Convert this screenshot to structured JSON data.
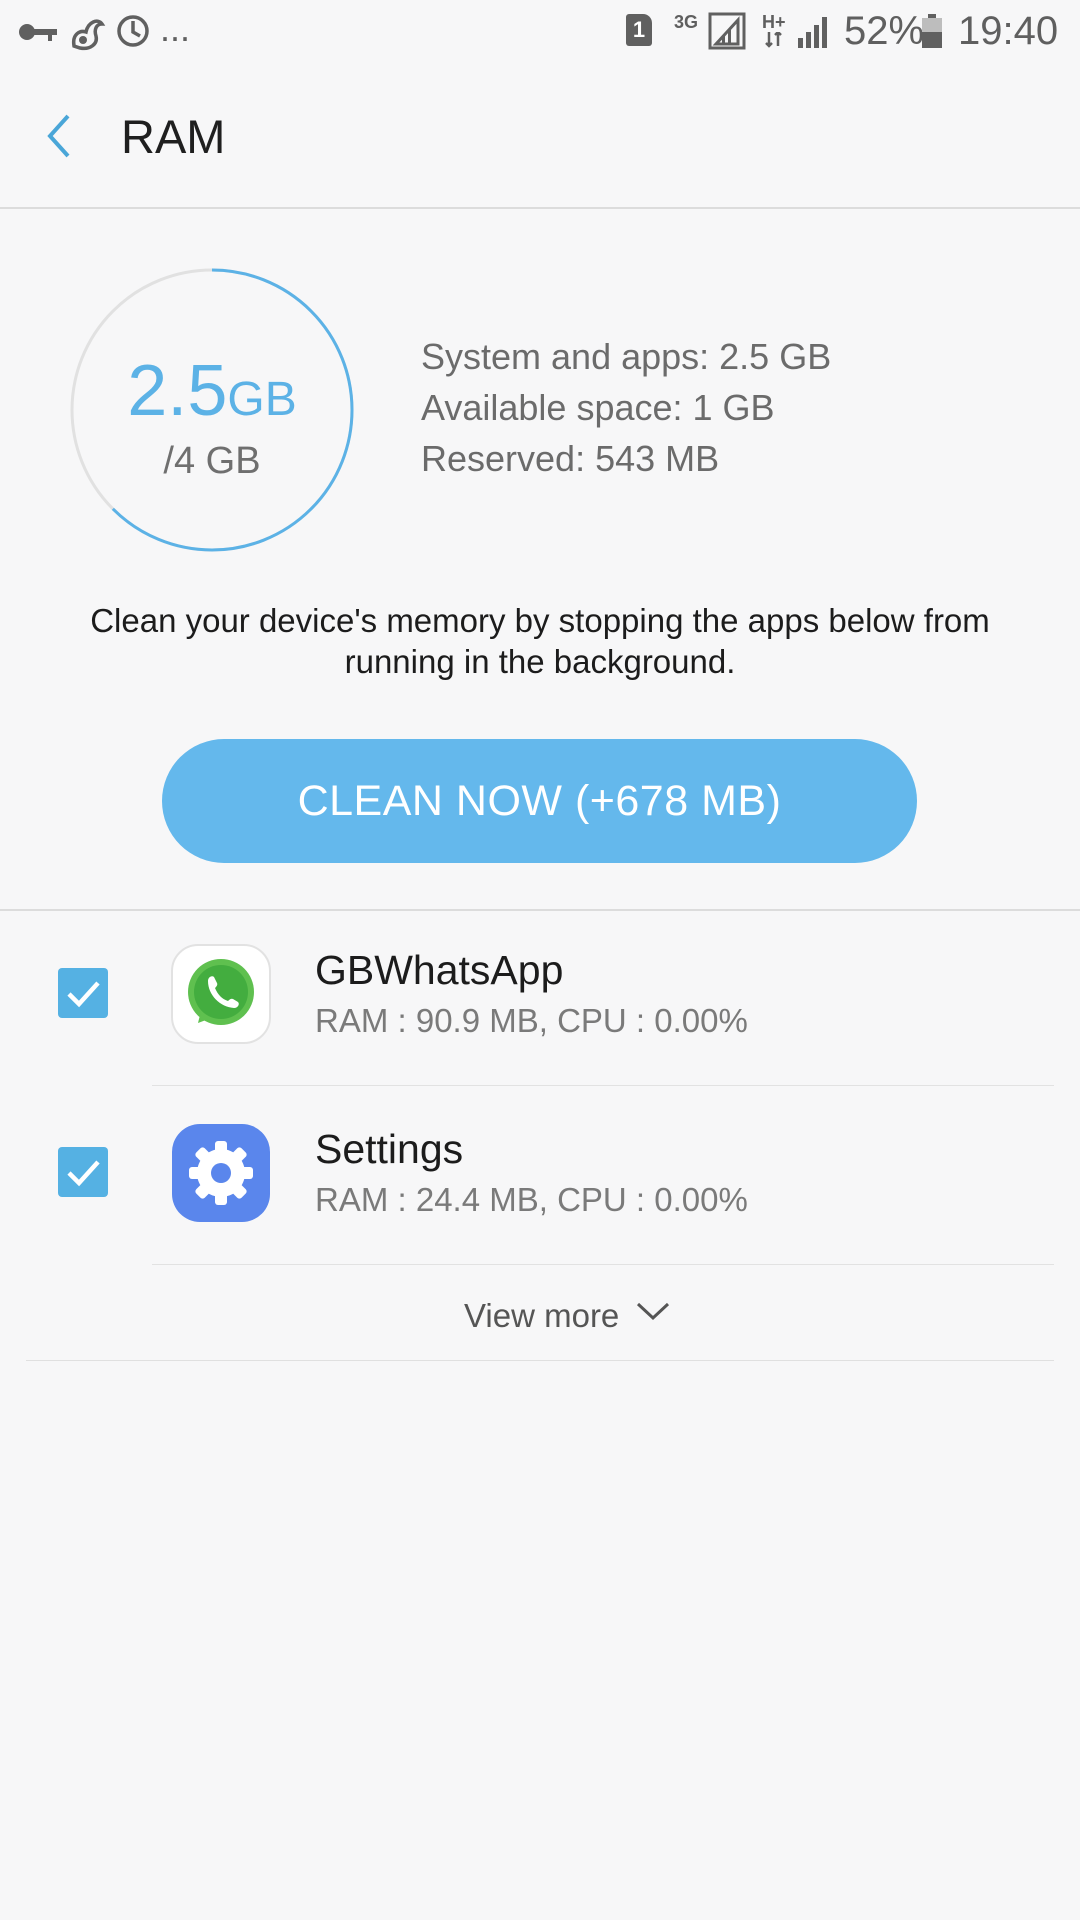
{
  "status_bar": {
    "left_icons": [
      "key-icon",
      "squirrel-icon",
      "sync-icon"
    ],
    "ellipsis": "...",
    "sim_slot": "1",
    "network_3g": "3G",
    "network_hplus": "H+",
    "battery_percent": "52%",
    "time": "19:40"
  },
  "header": {
    "back_icon": "chevron-left-icon",
    "title": "RAM"
  },
  "ram_summary": {
    "used_value": "2.5",
    "used_unit": "GB",
    "total": "/4 GB",
    "usage_fraction": 0.625,
    "accent_color": "#5cb2e6",
    "details": [
      "System and apps: 2.5 GB",
      "Available space: 1 GB",
      "Reserved: 543 MB"
    ]
  },
  "description": "Clean your device's memory by stopping the apps below from running in the background.",
  "clean_button": {
    "label": "CLEAN NOW (+678 MB)",
    "color": "#64b8ec"
  },
  "apps": [
    {
      "name": "GBWhatsApp",
      "stats": "RAM : 90.9 MB, CPU : 0.00%",
      "checked": true,
      "icon": "whatsapp-icon"
    },
    {
      "name": "Settings",
      "stats": "RAM : 24.4 MB, CPU : 0.00%",
      "checked": true,
      "icon": "settings-gear-icon"
    }
  ],
  "view_more": {
    "label": "View more",
    "icon": "chevron-down-icon"
  }
}
